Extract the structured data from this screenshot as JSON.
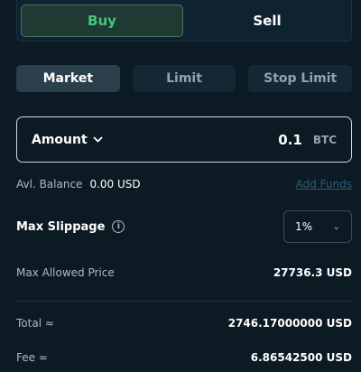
{
  "side": {
    "buy_label": "Buy",
    "sell_label": "Sell",
    "active": "Buy"
  },
  "order_tabs": [
    {
      "label": "Market",
      "active": true
    },
    {
      "label": "Limit",
      "active": false
    },
    {
      "label": "Stop Limit",
      "active": false
    }
  ],
  "amount": {
    "label": "Amount",
    "value": "0.1",
    "unit": "BTC"
  },
  "balance": {
    "label": "Avl. Balance",
    "value": "0.00 USD",
    "add_funds": "Add Funds"
  },
  "slippage": {
    "label": "Max Slippage",
    "value": "1%"
  },
  "max_price": {
    "label": "Max Allowed Price",
    "value": "27736.3 USD"
  },
  "total": {
    "label": "Total ≈",
    "value": "2746.17000000 USD"
  },
  "fee": {
    "label": "Fee ≈",
    "value": "6.86542500 USD"
  },
  "colors": {
    "buy_accent": "#49c47d",
    "background": "#0c1a24"
  }
}
